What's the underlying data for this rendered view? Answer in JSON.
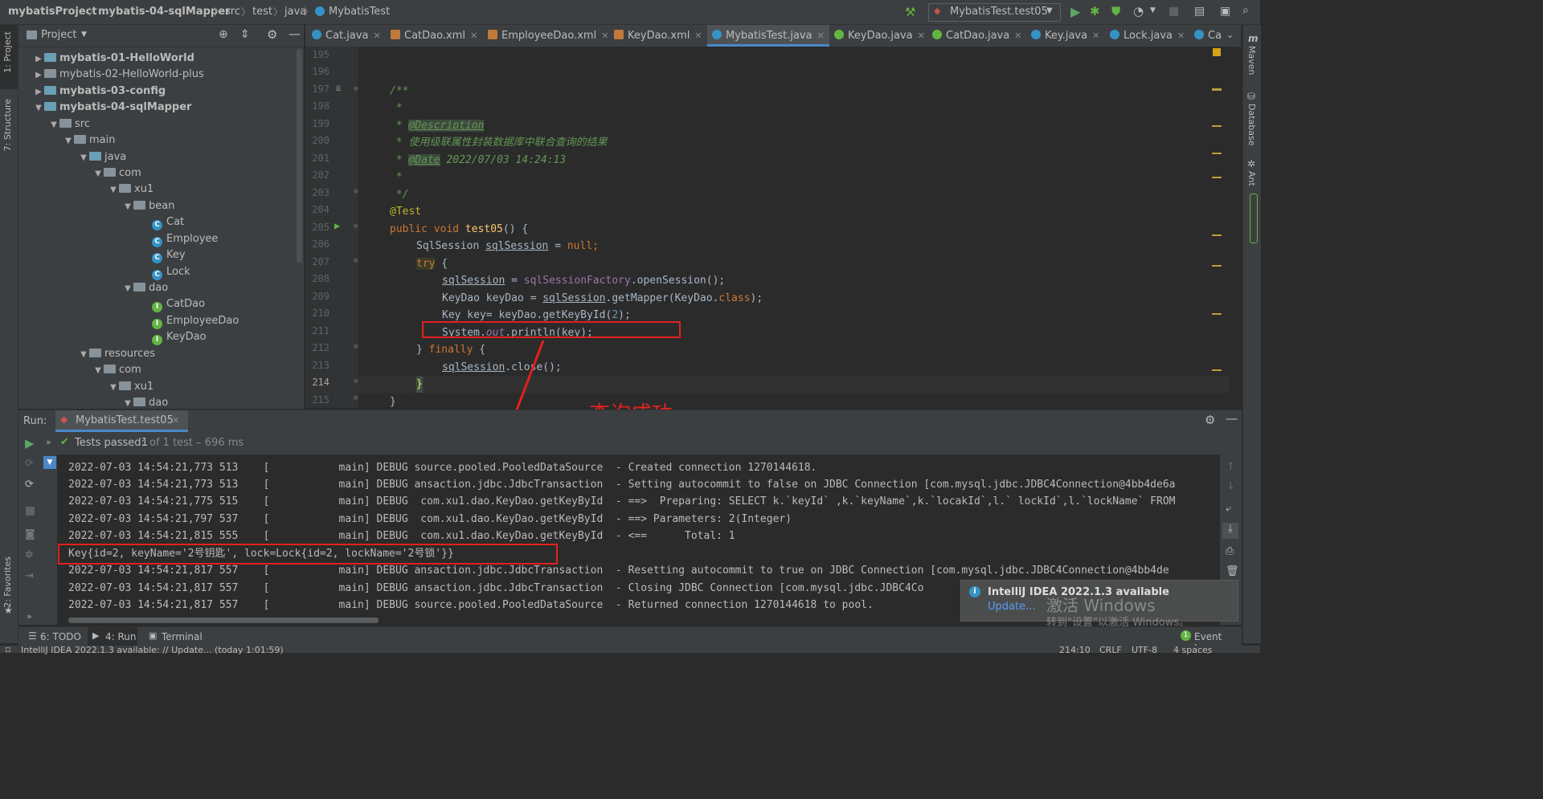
{
  "breadcrumb": [
    "mybatisProject",
    "mybatis-04-sqlMapper",
    "src",
    "test",
    "java",
    "MybatisTest"
  ],
  "run_config": "MybatisTest.test05",
  "left_tabs": [
    "1: Project",
    "7: Structure",
    "2: Favorites"
  ],
  "right_tabs": [
    "Maven",
    "Database",
    "Ant"
  ],
  "project_panel": {
    "title": "Project",
    "tree": [
      {
        "label": "mybatis-01-HelloWorld",
        "bold": true
      },
      {
        "label": "mybatis-02-HelloWorld-plus",
        "bold": false
      },
      {
        "label": "mybatis-03-config",
        "bold": true
      },
      {
        "label": "mybatis-04-sqlMapper",
        "bold": true
      },
      {
        "label": "src"
      },
      {
        "label": "main"
      },
      {
        "label": "java"
      },
      {
        "label": "com"
      },
      {
        "label": "xu1"
      },
      {
        "label": "bean"
      },
      {
        "label": "Cat"
      },
      {
        "label": "Employee"
      },
      {
        "label": "Key"
      },
      {
        "label": "Lock"
      },
      {
        "label": "dao"
      },
      {
        "label": "CatDao"
      },
      {
        "label": "EmployeeDao"
      },
      {
        "label": "KeyDao"
      },
      {
        "label": "resources"
      },
      {
        "label": "com"
      },
      {
        "label": "xu1"
      },
      {
        "label": "dao"
      }
    ]
  },
  "editor_tabs": [
    "Cat.java",
    "CatDao.xml",
    "EmployeeDao.xml",
    "KeyDao.xml",
    "MybatisTest.java",
    "KeyDao.java",
    "CatDao.java",
    "Key.java",
    "Lock.java",
    "Ca"
  ],
  "active_tab": "MybatisTest.java",
  "line_numbers": [
    "195",
    "196",
    "197",
    "198",
    "199",
    "200",
    "201",
    "202",
    "203",
    "204",
    "205",
    "206",
    "207",
    "208",
    "209",
    "210",
    "211",
    "212",
    "213",
    "214",
    "215"
  ],
  "code": {
    "l197": "/**",
    "l198": " *",
    "l199_star": " * ",
    "l199_tag": "@Description",
    "l200": " * 使用级联属性封装数据库中联合查询的结果",
    "l201_star": " * ",
    "l201_tag": "@Date",
    "l201_rest": " 2022/07/03 14:24:13",
    "l202": " *",
    "l203": " */",
    "l204": "@Test",
    "l205_kw": "public void ",
    "l205_fn": "test05",
    "l205_rest": "() {",
    "l206_type": "SqlSession ",
    "l206_var": "sqlSession",
    "l206_eq": " = ",
    "l206_null": "null",
    "l206_end": ";",
    "l207_try": "try",
    "l207_rest": " {",
    "l208_var": "sqlSession",
    "l208_eq": " = ",
    "l208_field": "sqlSessionFactory",
    "l208_rest": ".openSession();",
    "l209_a": "KeyDao keyDao = ",
    "l209_var": "sqlSession",
    "l209_b": ".getMapper(KeyDao.",
    "l209_class": "class",
    "l209_c": ");",
    "l210_a": "Key key= keyDao.getKeyById(",
    "l210_num": "2",
    "l210_b": ");",
    "l211_a": "System.",
    "l211_out": "out",
    "l211_b": ".println(key);",
    "l212_a": "} ",
    "l212_kw": "finally",
    "l212_b": " {",
    "l213_var": "sqlSession",
    "l213_rest": ".close();",
    "l214": "}",
    "l215": "}"
  },
  "annotation": "查询成功",
  "run_panel": {
    "label": "Run:",
    "tab": "MybatisTest.test05",
    "tests_passed": "Tests passed:",
    "tests_count": "1",
    "tests_rest": "of 1 test – 696 ms"
  },
  "console_lines": [
    "2022-07-03 14:54:21,773 513    [           main] DEBUG source.pooled.PooledDataSource  - Created connection 1270144618.",
    "2022-07-03 14:54:21,773 513    [           main] DEBUG ansaction.jdbc.JdbcTransaction  - Setting autocommit to false on JDBC Connection [com.mysql.jdbc.JDBC4Connection@4bb4de6a",
    "2022-07-03 14:54:21,775 515    [           main] DEBUG  com.xu1.dao.KeyDao.getKeyById  - ==>  Preparing: SELECT k.`keyId` ,k.`keyName`,k.`locakId`,l.` lockId`,l.`lockName` FROM",
    "2022-07-03 14:54:21,797 537    [           main] DEBUG  com.xu1.dao.KeyDao.getKeyById  - ==> Parameters: 2(Integer)",
    "2022-07-03 14:54:21,815 555    [           main] DEBUG  com.xu1.dao.KeyDao.getKeyById  - <==      Total: 1",
    "Key{id=2, keyName='2号钥匙', lock=Lock{id=2, lockName='2号锁'}}",
    "2022-07-03 14:54:21,817 557    [           main] DEBUG ansaction.jdbc.JdbcTransaction  - Resetting autocommit to true on JDBC Connection [com.mysql.jdbc.JDBC4Connection@4bb4de",
    "2022-07-03 14:54:21,817 557    [           main] DEBUG ansaction.jdbc.JdbcTransaction  - Closing JDBC Connection [com.mysql.jdbc.JDBC4Co",
    "2022-07-03 14:54:21,817 557    [           main] DEBUG source.pooled.PooledDataSource  - Returned connection 1270144618 to pool."
  ],
  "bottom_tabs": [
    "6: TODO",
    "4: Run",
    "Terminal"
  ],
  "event_log": "Event Log",
  "notification": {
    "title": "IntelliJ IDEA 2022.1.3 available",
    "link": "Update...",
    "watermark1": "激活 Windows",
    "watermark2": "转到\"设置\"以激活 Windows。"
  },
  "status": {
    "left": "IntelliJ IDEA 2022.1.3 available: // Update... (today 1:01:59)",
    "position": "214:10",
    "line_sep": "CRLF",
    "encoding": "UTF-8",
    "indent": "4 spaces"
  }
}
